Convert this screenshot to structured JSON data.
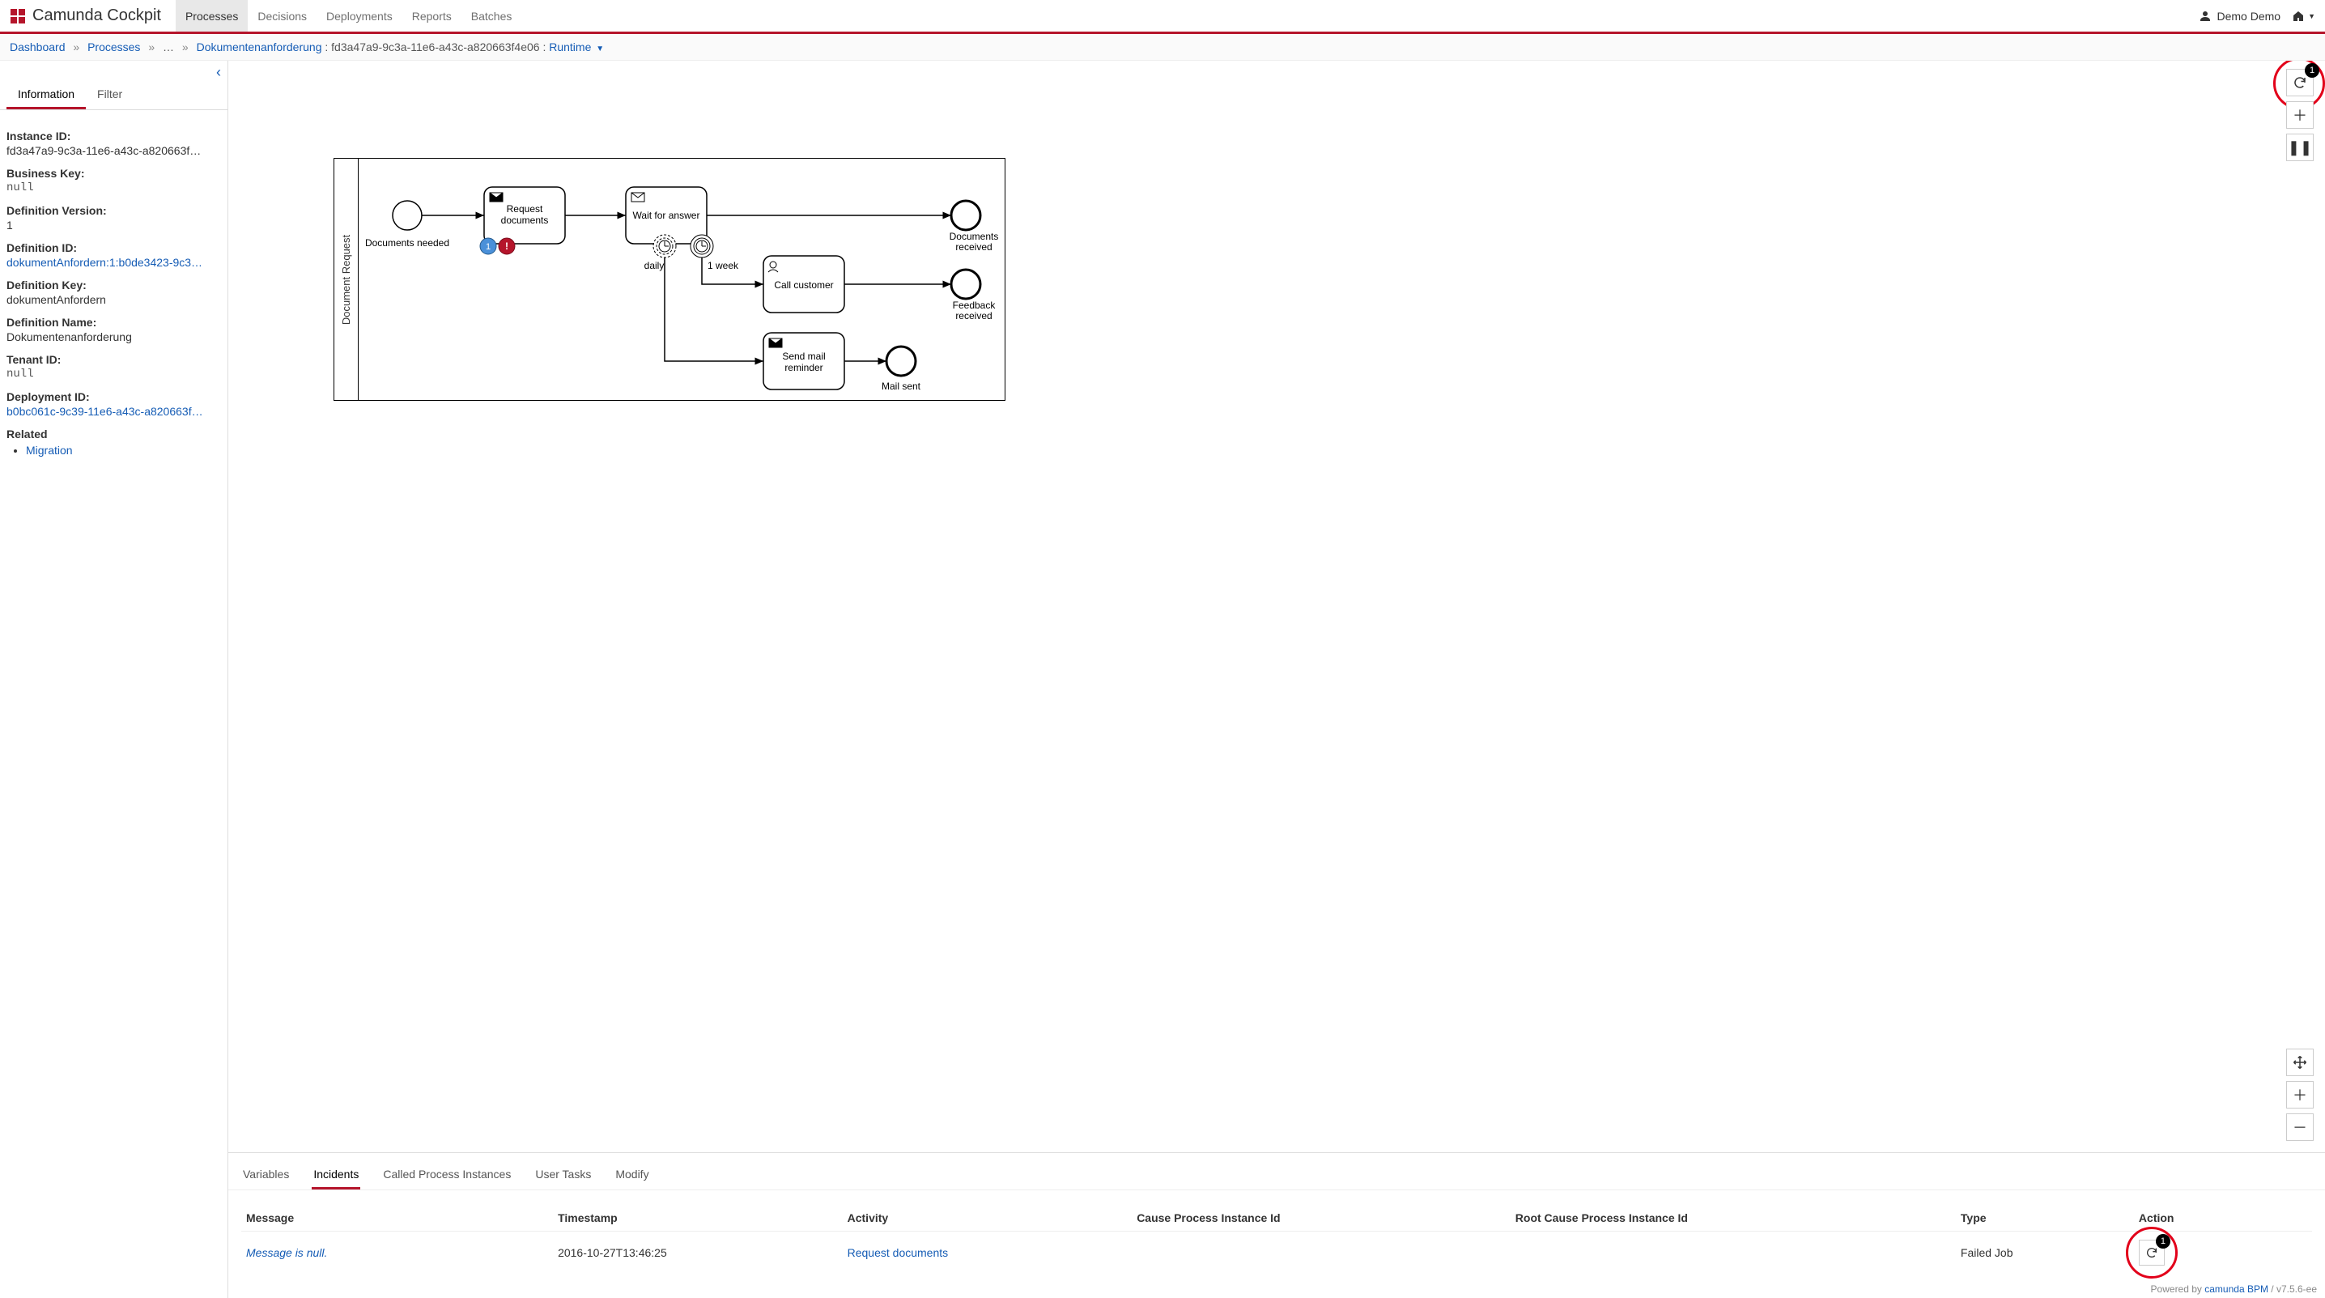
{
  "brand": "Camunda Cockpit",
  "nav": {
    "items": [
      "Processes",
      "Decisions",
      "Deployments",
      "Reports",
      "Batches"
    ],
    "active": 0
  },
  "user": {
    "name": "Demo Demo"
  },
  "breadcrumb": {
    "dashboard": "Dashboard",
    "processes": "Processes",
    "ellipsis": "…",
    "processDef": "Dokumentenanforderung",
    "instanceId": "fd3a47a9-9c3a-11e6-a43c-a820663f4e06",
    "runtime": "Runtime"
  },
  "sidebar": {
    "tabs": {
      "information": "Information",
      "filter": "Filter"
    },
    "info": {
      "instanceId_label": "Instance ID:",
      "instanceId": "fd3a47a9-9c3a-11e6-a43c-a820663f…",
      "businessKey_label": "Business Key:",
      "businessKey": "null",
      "defVersion_label": "Definition Version:",
      "defVersion": "1",
      "defId_label": "Definition ID:",
      "defId": "dokumentAnfordern:1:b0de3423-9c3…",
      "defKey_label": "Definition Key:",
      "defKey": "dokumentAnfordern",
      "defName_label": "Definition Name:",
      "defName": "Dokumentenanforderung",
      "tenantId_label": "Tenant ID:",
      "tenantId": "null",
      "deploymentId_label": "Deployment ID:",
      "deploymentId": "b0bc061c-9c39-11e6-a43c-a820663f…",
      "related_label": "Related",
      "related_migration": "Migration"
    }
  },
  "diagram": {
    "pool": "Document Request",
    "startEvent": "Documents needed",
    "task_request": "Request documents",
    "task_wait": "Wait for answer",
    "timer_daily": "daily",
    "timer_week": "1 week",
    "task_call": "Call customer",
    "task_reminder": "Send mail reminder",
    "end_docs": "Documents received",
    "end_feedback": "Feedback received",
    "end_mail": "Mail sent",
    "token_count": "1",
    "incident_mark": "!"
  },
  "toolbar": {
    "refresh_badge": "1"
  },
  "bottomTabs": {
    "variables": "Variables",
    "incidents": "Incidents",
    "called": "Called Process Instances",
    "userTasks": "User Tasks",
    "modify": "Modify"
  },
  "incidents": {
    "headers": {
      "message": "Message",
      "timestamp": "Timestamp",
      "activity": "Activity",
      "cause": "Cause Process Instance Id",
      "rootCause": "Root Cause Process Instance Id",
      "type": "Type",
      "action": "Action"
    },
    "rows": [
      {
        "message": "Message is null.",
        "timestamp": "2016-10-27T13:46:25",
        "activity": "Request documents",
        "cause": "",
        "rootCause": "",
        "type": "Failed Job",
        "action_badge": "1"
      }
    ]
  },
  "footer": {
    "powered": "Powered by ",
    "product": "camunda BPM",
    "version": " / v7.5.6-ee"
  }
}
